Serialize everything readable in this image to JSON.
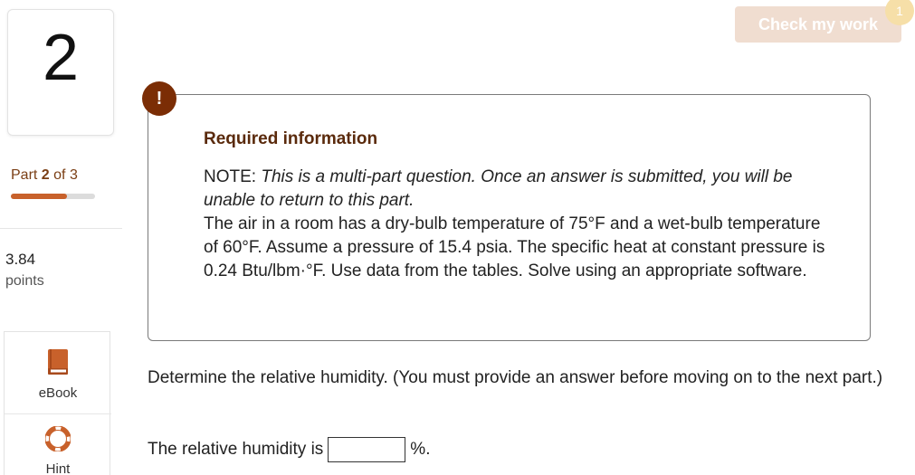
{
  "question": {
    "number": "2",
    "part_prefix": "Part ",
    "part_current": "2",
    "part_suffix": " of 3",
    "progress": 0.667,
    "points_value": "3.84",
    "points_label": "points"
  },
  "tools": {
    "ebook_label": "eBook",
    "hint_label": "Hint"
  },
  "header": {
    "check_label": "Check my work",
    "check_badge": "1"
  },
  "info": {
    "alert_symbol": "!",
    "title": "Required information",
    "note_prefix": "NOTE: ",
    "note_italic": "This is a multi-part question. Once an answer is submitted, you will be unable to return to this part.",
    "body": "The air in a room has a dry-bulb temperature of 75°F and a wet-bulb temperature of 60°F. Assume a pressure of 15.4 psia. The specific heat at constant pressure is 0.24 Btu/lbm·°F. Use data from the tables. Solve using an appropriate software."
  },
  "prompt": {
    "text": "Determine the relative humidity. (You must provide an answer before moving on to the next part.)",
    "answer_prefix": "The relative humidity is",
    "answer_value": "",
    "answer_suffix": "%."
  },
  "colors": {
    "accent": "#c8612b",
    "alert": "#7b2d05",
    "title": "#5a2a0c",
    "button_disabled": "#f0ddd0",
    "badge": "#f6dfa8"
  }
}
